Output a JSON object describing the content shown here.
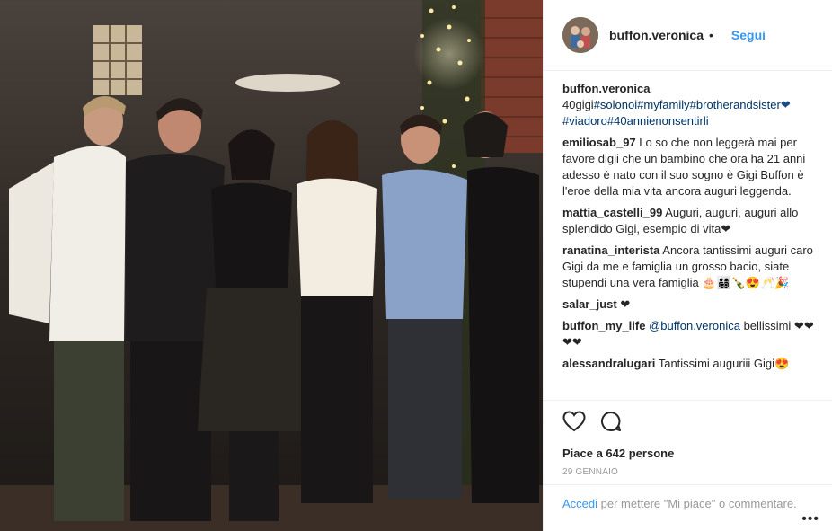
{
  "post": {
    "username": "buffon.veronica",
    "separator": "•",
    "follow_label": "Segui",
    "caption": {
      "author": "buffon.veronica",
      "text": "40gigi",
      "tags": [
        "#solonoi",
        "#myfamily",
        "#brotherandsister",
        "#viadoro",
        "#40annienonsentirli"
      ],
      "heart": "❤"
    },
    "comments": [
      {
        "author": "emiliosab_97",
        "text": "Lo so che non leggerà mai per favore digli che un bambino che ora ha 21 anni adesso è nato con il suo sogno è Gigi Buffon è l'eroe della mia vita ancora auguri leggenda."
      },
      {
        "author": "mattia_castelli_99",
        "text": "Auguri, auguri, auguri allo splendido Gigi, esempio di vita❤"
      },
      {
        "author": "ranatina_interista",
        "text": "Ancora tantissimi auguri caro Gigi da me e famiglia un grosso bacio, siate stupendi una vera famiglia 🎂👨‍👩‍👧‍👦🍾😍🥂🎉"
      },
      {
        "author": "salar_just",
        "text": "❤"
      },
      {
        "author": "buffon_my_life",
        "mention": "@buffon.veronica",
        "text": "bellissimi ❤❤❤❤"
      },
      {
        "author": "alessandralugari",
        "text": "Tantissimi auguriii Gigi😍"
      }
    ],
    "likes_text": "Piace a 642 persone",
    "date": "29 GENNAIO",
    "login_link": "Accedi",
    "login_text": "per mettere \"Mi piace\" o commentare.",
    "more_label": "•••"
  },
  "icons": {
    "like": "heart-outline-icon",
    "comment": "speech-bubble-icon",
    "more": "ellipsis-icon"
  },
  "colors": {
    "link_blue": "#3897f0",
    "tag_blue": "#003569",
    "text": "#262626",
    "muted": "#999999",
    "border": "#efefef"
  }
}
